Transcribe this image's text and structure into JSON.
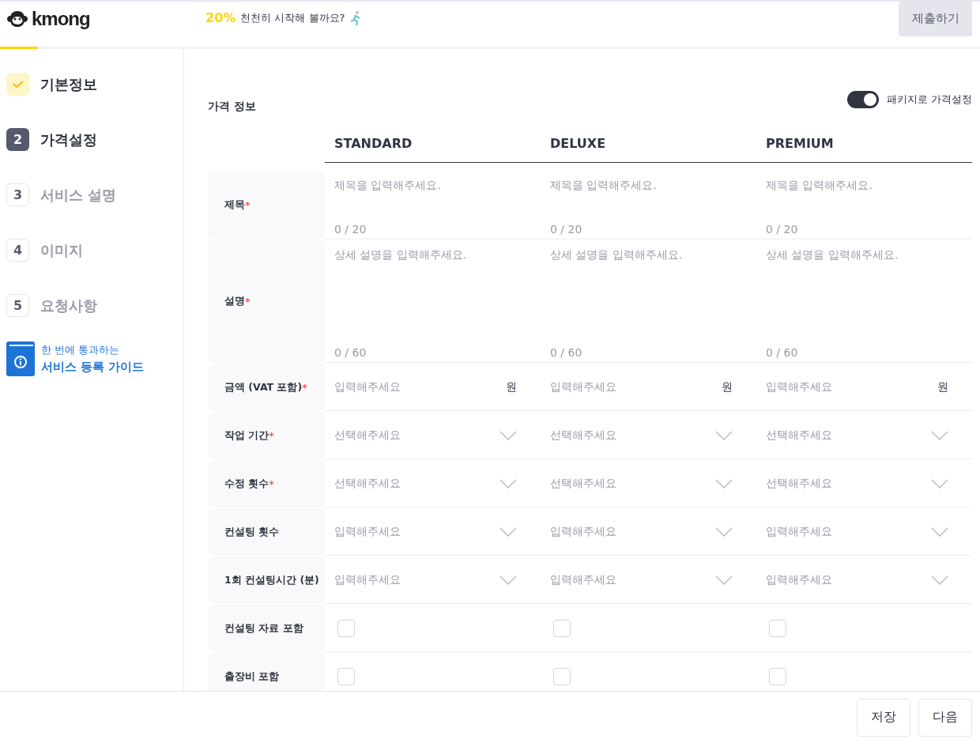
{
  "header": {
    "logo": "kmong",
    "progress": "20%",
    "progress_message": "천천히 시작해 볼까요?",
    "submit_button": "제출하기"
  },
  "sidebar": {
    "steps": [
      {
        "label": "기본정보",
        "completed": true,
        "selected": false
      },
      {
        "number": "2",
        "label": "가격설정",
        "completed": false,
        "selected": true
      },
      {
        "number": "3",
        "label": "서비스 설명",
        "completed": false,
        "selected": false
      },
      {
        "number": "4",
        "label": "이미지",
        "completed": false,
        "selected": false
      },
      {
        "number": "5",
        "label": "요청사항",
        "completed": false,
        "selected": false
      }
    ],
    "guide": {
      "line_1": "한 번에 통과하는",
      "line_2": "서비스 등록 가이드"
    }
  },
  "pricing": {
    "title": "가격 정보",
    "package_toggle": {
      "label": "패키지로 가격설정",
      "on": true
    },
    "packages": [
      "STANDARD",
      "DELUXE",
      "PREMIUM"
    ],
    "rows": [
      {
        "label": "제목",
        "required_mark": "*",
        "kind": "text",
        "cells": [
          {
            "placeholder": "제목을 입력해주세요.",
            "counter": "0 / 20"
          },
          {
            "placeholder": "제목을 입력해주세요.",
            "counter": "0 / 20"
          },
          {
            "placeholder": "제목을 입력해주세요.",
            "counter": "0 / 20"
          }
        ]
      },
      {
        "label": "설명",
        "required_mark": "*",
        "kind": "textarea",
        "cells": [
          {
            "placeholder": "상세 설명을 입력해주세요.",
            "counter": "0 / 60"
          },
          {
            "placeholder": "상세 설명을 입력해주세요.",
            "counter": "0 / 60"
          },
          {
            "placeholder": "상세 설명을 입력해주세요.",
            "counter": "0 / 60"
          }
        ]
      },
      {
        "label": "금액 (VAT 포함)",
        "required_mark": "*",
        "kind": "price",
        "cells": [
          {
            "placeholder": "입력해주세요",
            "unit": "원"
          },
          {
            "placeholder": "입력해주세요",
            "unit": "원"
          },
          {
            "placeholder": "입력해주세요",
            "unit": "원"
          }
        ]
      },
      {
        "label": "작업 기간",
        "required_mark": "*",
        "kind": "select",
        "cells": [
          {
            "placeholder": "선택해주세요"
          },
          {
            "placeholder": "선택해주세요"
          },
          {
            "placeholder": "선택해주세요"
          }
        ]
      },
      {
        "label": "수정 횟수",
        "required_mark": "*",
        "kind": "select",
        "cells": [
          {
            "placeholder": "선택해주세요"
          },
          {
            "placeholder": "선택해주세요"
          },
          {
            "placeholder": "선택해주세요"
          }
        ]
      },
      {
        "label": "컨설팅 횟수",
        "kind": "select",
        "cells": [
          {
            "placeholder": "입력해주세요"
          },
          {
            "placeholder": "입력해주세요"
          },
          {
            "placeholder": "입력해주세요"
          }
        ]
      },
      {
        "label": "1회 컨설팅시간 (분)",
        "kind": "select",
        "cells": [
          {
            "placeholder": "입력해주세요"
          },
          {
            "placeholder": "입력해주세요"
          },
          {
            "placeholder": "입력해주세요"
          }
        ]
      },
      {
        "label": "컨설팅 자료 포함",
        "kind": "checkbox",
        "cells": [
          {
            "checked": false
          },
          {
            "checked": false
          },
          {
            "checked": false
          }
        ]
      },
      {
        "label": "출장비 포함",
        "kind": "checkbox",
        "cells": [
          {
            "checked": false
          },
          {
            "checked": false
          },
          {
            "checked": false
          }
        ]
      }
    ]
  },
  "footer": {
    "save_button": "저장",
    "next_button": "다음"
  }
}
